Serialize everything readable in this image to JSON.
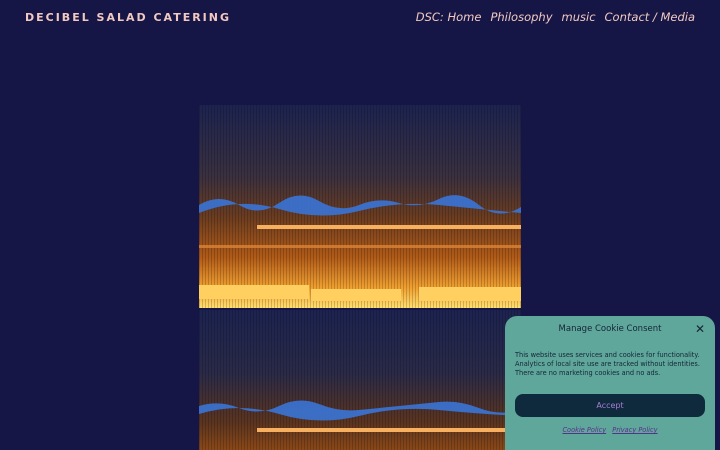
{
  "site": {
    "title": "DECIBEL SALAD CATERING"
  },
  "nav": {
    "items": [
      {
        "label": "DSC: Home"
      },
      {
        "label": "Philosophy"
      },
      {
        "label": "music"
      },
      {
        "label": "Contact / Media"
      }
    ]
  },
  "colors": {
    "background": "#161646",
    "nav_text": "#f2c9c0",
    "cookie_bg": "#5fa79a",
    "accept_bg": "#0f2a3c"
  },
  "cookie": {
    "title": "Manage Cookie Consent",
    "close_icon": "close-icon",
    "text": "This website uses services and cookies for functionality. Analytics of local site use are tracked without identities. There are no marketing cookies and no ads.",
    "accept_label": "Accept",
    "cookie_policy_label": "Cookie Policy",
    "privacy_policy_label": "Privacy Policy"
  }
}
